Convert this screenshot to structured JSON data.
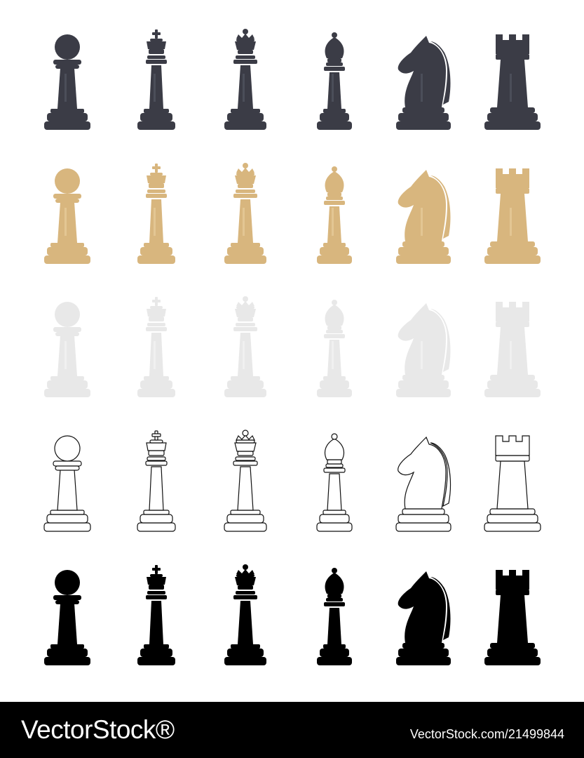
{
  "pieces": [
    "pawn",
    "king",
    "queen",
    "bishop",
    "knight",
    "rook"
  ],
  "rows": [
    {
      "style": "dark",
      "fill": "#3b3c46",
      "highlight": "#5a5c69",
      "stroke": "none"
    },
    {
      "style": "wood",
      "fill": "#d8b67e",
      "highlight": "#ecd3a4",
      "stroke": "none"
    },
    {
      "style": "light",
      "fill": "#e8e8e8",
      "highlight": "#f6f6f6",
      "stroke": "none"
    },
    {
      "style": "outline",
      "fill": "#ffffff",
      "highlight": "#ffffff",
      "stroke": "#111111"
    },
    {
      "style": "silhouette",
      "fill": "#000000",
      "highlight": "#000000",
      "stroke": "none"
    }
  ],
  "footer": {
    "logo": "VectorStock®",
    "stock_id": "VectorStock.com/21499844"
  }
}
